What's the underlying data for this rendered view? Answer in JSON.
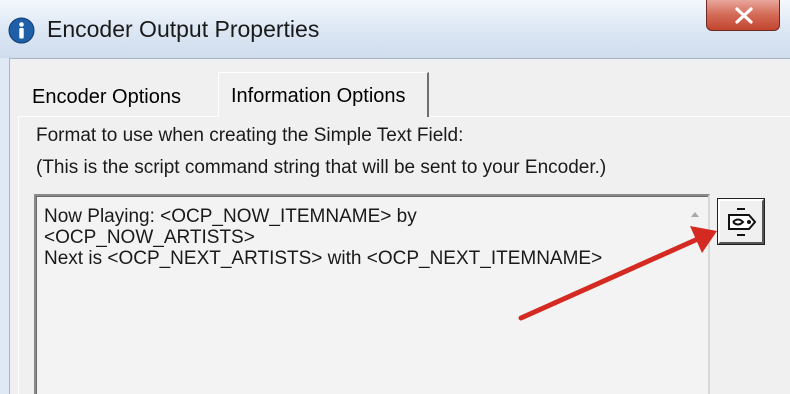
{
  "window": {
    "title": "Encoder Output Properties",
    "icons": {
      "app": "info-icon",
      "close": "close-icon"
    }
  },
  "tabs": [
    {
      "label": "Encoder Options",
      "active": false
    },
    {
      "label": "Information Options",
      "active": true
    }
  ],
  "info_tab": {
    "format_label": "Format to use when creating the Simple Text Field:",
    "format_hint": "(This is the script command string that will be sent to your Encoder.)",
    "script_lines": [
      "Now Playing: <OCP_NOW_ITEMNAME> by",
      "<OCP_NOW_ARTISTS>",
      "Next is <OCP_NEXT_ARTISTS> with <OCP_NEXT_ITEMNAME>"
    ],
    "edit_button_icon": "edit-tag-icon"
  },
  "annotation": {
    "icon": "red-arrow-icon",
    "color": "#d42a22"
  },
  "colors": {
    "close_button": "#c2452f",
    "info_icon": "#1f5fa8",
    "arrow": "#d42a22"
  }
}
